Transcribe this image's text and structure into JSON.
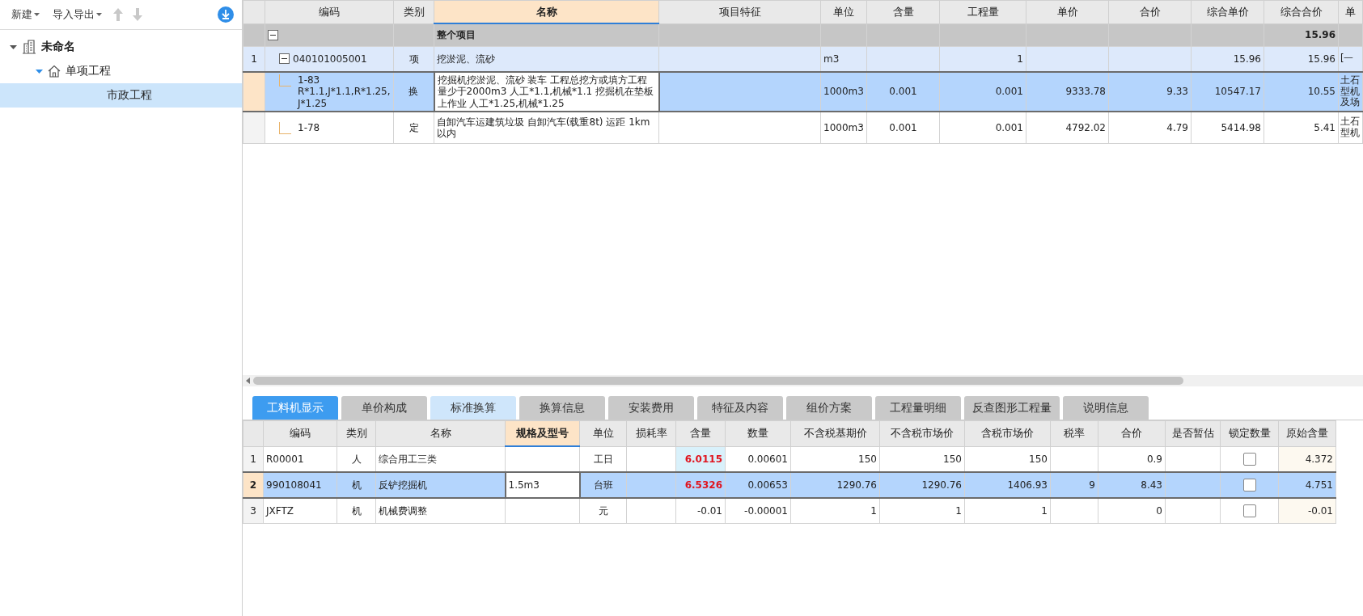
{
  "sidebar": {
    "toolbar": [
      {
        "label": "新建",
        "kind": "dropdown",
        "disabled": false
      },
      {
        "label": "导入导出",
        "kind": "dropdown",
        "disabled": false
      },
      {
        "kind": "up",
        "disabled": true
      },
      {
        "kind": "down",
        "disabled": true
      },
      {
        "kind": "download",
        "disabled": false
      }
    ],
    "tree": [
      {
        "label": "未命名",
        "kind": "root",
        "expanded": true,
        "selected": false,
        "children": [
          {
            "label": "单项工程",
            "kind": "folder",
            "expanded": true,
            "selected": false,
            "children": [
              {
                "label": "市政工程",
                "kind": "leaf",
                "selected": true
              }
            ]
          }
        ]
      }
    ]
  },
  "top_table": {
    "columns": [
      {
        "selected": false
      },
      {
        "label": "编码",
        "selected": false
      },
      {
        "label": "类别",
        "selected": false
      },
      {
        "label": "名称",
        "selected": true
      },
      {
        "label": "项目特征",
        "selected": false
      },
      {
        "label": "单位",
        "selected": false
      },
      {
        "label": "含量",
        "selected": false
      },
      {
        "label": "工程量",
        "selected": false
      },
      {
        "label": "单价",
        "selected": false
      },
      {
        "label": "合价",
        "selected": false
      },
      {
        "label": "综合单价",
        "selected": false
      },
      {
        "label": "综合合价",
        "selected": false
      },
      {
        "label": "单",
        "selected": false
      }
    ],
    "rows": [
      {
        "kind": "group",
        "selected": false,
        "expanded": true,
        "name": "整个项目",
        "comp_total_price": "15.96"
      },
      {
        "kind": "item",
        "selected": false,
        "expanded": true,
        "number": "1",
        "code": "040101005001",
        "category": "项",
        "name": "挖淤泥、流砂",
        "unit": "m3",
        "quantity": "1",
        "comp_unit_price": "15.96",
        "comp_total_price": "15.96",
        "column_13": "[一"
      },
      {
        "kind": "sub",
        "selected": true,
        "code": "1-83",
        "conversion": "R*1.1,J*1.1,R*1.25,J*1.25",
        "category": "换",
        "name": "挖掘机挖淤泥、流砂 装车  工程总挖方或填方工程量少于2000m3 人工*1.1,机械*1.1  挖掘机在垫板上作业 人工*1.25,机械*1.25",
        "unit": "1000m3",
        "content": "0.001",
        "quantity": "0.001",
        "unit_price": "9333.78",
        "total_price": "9.33",
        "comp_unit_price": "10547.17",
        "comp_total_price": "10.55",
        "column_13": "土石型机及场"
      },
      {
        "kind": "sub",
        "selected": false,
        "code": "1-78",
        "category": "定",
        "name": "自卸汽车运建筑垃圾 自卸汽车(载重8t) 运距 1km以内",
        "unit": "1000m3",
        "content": "0.001",
        "quantity": "0.001",
        "unit_price": "4792.02",
        "total_price": "4.79",
        "comp_unit_price": "5414.98",
        "comp_total_price": "5.41",
        "column_13": "土石型机"
      }
    ]
  },
  "tabs": [
    {
      "label": "工料机显示",
      "selected": true,
      "highlighted": false
    },
    {
      "label": "单价构成",
      "selected": false,
      "highlighted": false
    },
    {
      "label": "标准换算",
      "selected": false,
      "highlighted": true
    },
    {
      "label": "换算信息",
      "selected": false,
      "highlighted": false
    },
    {
      "label": "安装费用",
      "selected": false,
      "highlighted": false
    },
    {
      "label": "特征及内容",
      "selected": false,
      "highlighted": false
    },
    {
      "label": "组价方案",
      "selected": false,
      "highlighted": false
    },
    {
      "label": "工程量明细",
      "selected": false,
      "highlighted": false
    },
    {
      "label": "反查图形工程量",
      "selected": false,
      "highlighted": false
    },
    {
      "label": "说明信息",
      "selected": false,
      "highlighted": false
    }
  ],
  "bottom_table": {
    "columns": [
      {
        "selected": false
      },
      {
        "label": "编码",
        "selected": false
      },
      {
        "label": "类别",
        "selected": false
      },
      {
        "label": "名称",
        "selected": false
      },
      {
        "label": "规格及型号",
        "selected": true
      },
      {
        "label": "单位",
        "selected": false
      },
      {
        "label": "损耗率",
        "selected": false
      },
      {
        "label": "含量",
        "selected": false
      },
      {
        "label": "数量",
        "selected": false
      },
      {
        "label": "不含税基期价",
        "selected": false
      },
      {
        "label": "不含税市场价",
        "selected": false
      },
      {
        "label": "含税市场价",
        "selected": false
      },
      {
        "label": "税率",
        "selected": false
      },
      {
        "label": "合价",
        "selected": false
      },
      {
        "label": "是否暂估",
        "selected": false
      },
      {
        "label": "锁定数量",
        "selected": false
      },
      {
        "label": "原始含量",
        "selected": false
      }
    ],
    "rows": [
      {
        "selected": false,
        "number": "1",
        "code": "R00001",
        "category": "人",
        "name": "综合用工三类",
        "unit": "工日",
        "content": "6.0115",
        "content_modified": true,
        "amount": "0.00601",
        "base_price": "150",
        "market_price": "150",
        "tax_market_price": "150",
        "total": "0.9",
        "locked": false,
        "original_content": "4.372"
      },
      {
        "selected": true,
        "number": "2",
        "code": "990108041",
        "category": "机",
        "name": "反铲挖掘机",
        "spec": "1.5m3",
        "unit": "台班",
        "content": "6.5326",
        "content_modified": true,
        "amount": "0.00653",
        "base_price": "1290.76",
        "market_price": "1290.76",
        "tax_market_price": "1406.93",
        "tax_rate": "9",
        "total": "8.43",
        "locked": false,
        "original_content": "4.751"
      },
      {
        "selected": false,
        "number": "3",
        "code": "JXFTZ",
        "category": "机",
        "name": "机械费调整",
        "unit": "元",
        "content": "-0.01",
        "content_modified": false,
        "amount": "-0.00001",
        "base_price": "1",
        "market_price": "1",
        "tax_market_price": "1",
        "total": "0",
        "locked": false,
        "original_content": "-0.01"
      }
    ]
  }
}
